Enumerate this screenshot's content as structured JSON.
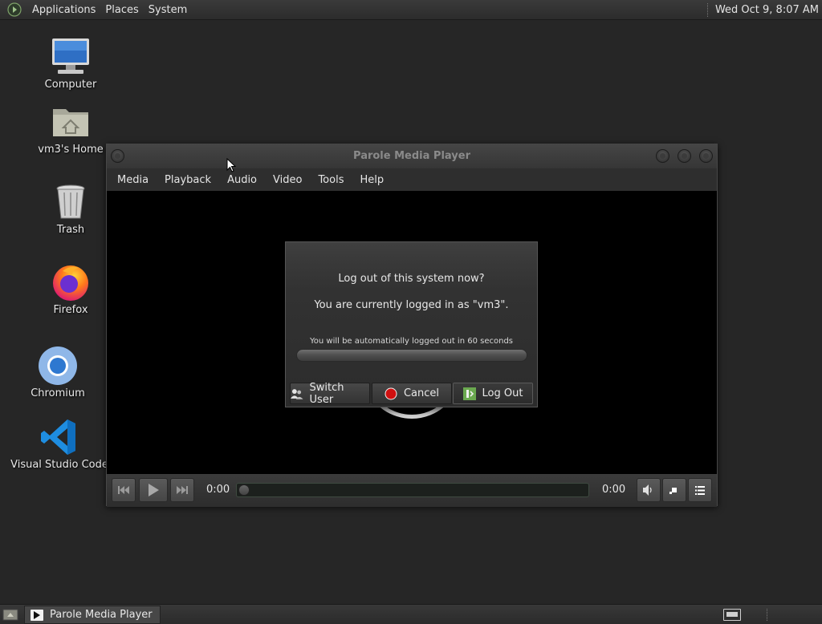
{
  "top_panel": {
    "menus": [
      "Applications",
      "Places",
      "System"
    ],
    "clock": "Wed Oct  9,  8:07 AM"
  },
  "desktop_icons": [
    {
      "label": "Computer",
      "icon": "computer-icon"
    },
    {
      "label": "vm3's Home",
      "icon": "home-folder-icon"
    },
    {
      "label": "Trash",
      "icon": "trash-icon"
    },
    {
      "label": "Firefox",
      "icon": "firefox-icon"
    },
    {
      "label": "Chromium",
      "icon": "chromium-icon"
    },
    {
      "label": "Visual Studio Code",
      "icon": "vscode-icon"
    }
  ],
  "player": {
    "title": "Parole Media Player",
    "menus": [
      "Media",
      "Playback",
      "Audio",
      "Video",
      "Tools",
      "Help"
    ],
    "time_elapsed": "0:00",
    "time_total": "0:00",
    "seek_position": 0
  },
  "logout_dialog": {
    "question": "Log out of this system now?",
    "info": "You are currently logged in as \"vm3\".",
    "auto_text": "You will be automatically logged out in 60 seconds",
    "buttons": {
      "switch_user": "Switch User",
      "cancel": "Cancel",
      "log_out": "Log Out"
    }
  },
  "bottom_panel": {
    "task_label": "Parole Media Player"
  },
  "colors": {
    "desktop_bg": "#262626",
    "panel_bg": "#333333",
    "accent_green": "#6aa84f",
    "cancel_red": "#d01010"
  }
}
